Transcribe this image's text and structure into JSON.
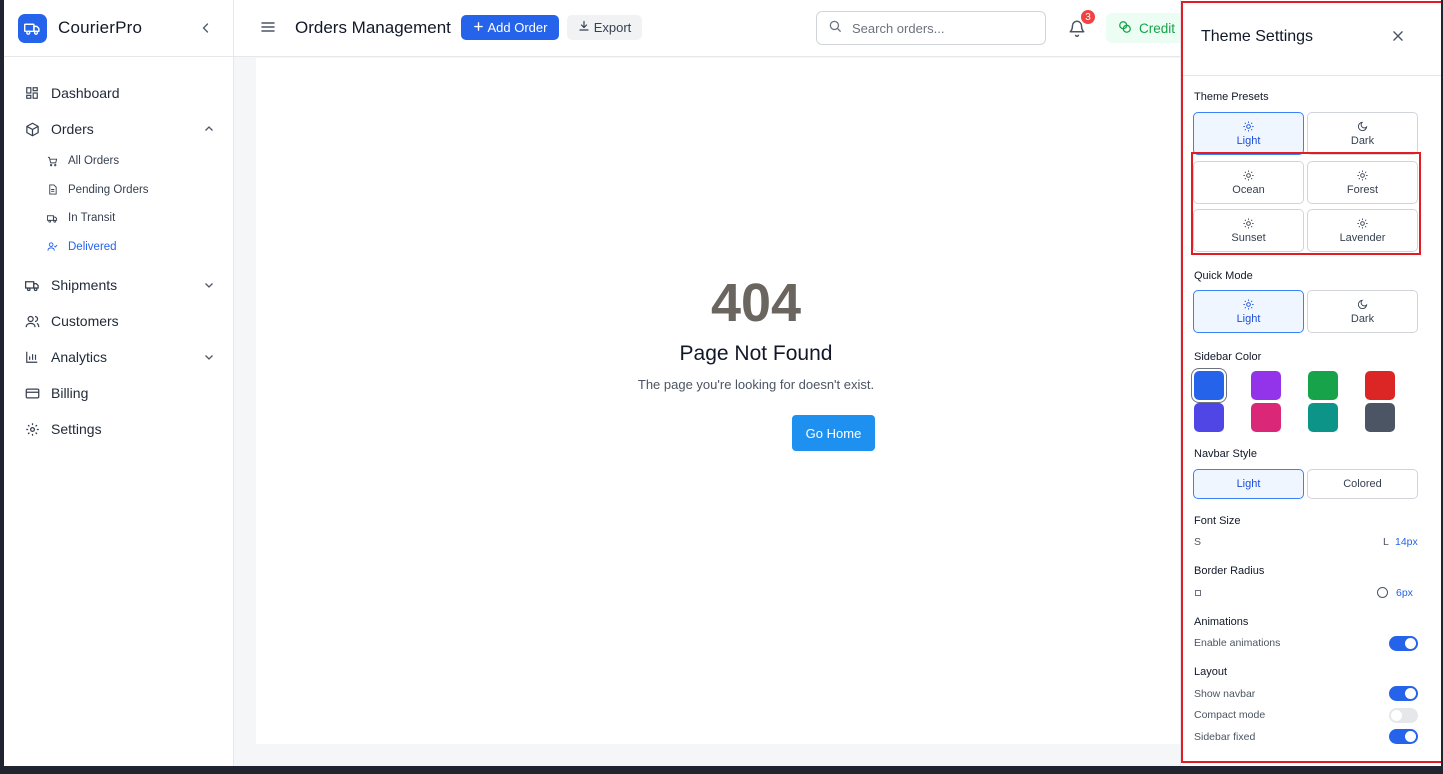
{
  "brand": {
    "name": "CourierPro"
  },
  "sidebar": {
    "items": [
      {
        "label": "Dashboard"
      },
      {
        "label": "Orders"
      },
      {
        "label": "Shipments"
      },
      {
        "label": "Customers"
      },
      {
        "label": "Analytics"
      },
      {
        "label": "Billing"
      },
      {
        "label": "Settings"
      }
    ],
    "orders_sub": [
      {
        "label": "All Orders"
      },
      {
        "label": "Pending Orders"
      },
      {
        "label": "In Transit"
      },
      {
        "label": "Delivered"
      }
    ]
  },
  "topbar": {
    "title": "Orders Management",
    "add_label": "Add Order",
    "export_label": "Export",
    "search_placeholder": "Search orders...",
    "notification_count": "3",
    "credit_label": "Credit"
  },
  "main": {
    "error_code": "404",
    "error_title": "Page Not Found",
    "error_message": "The page you're looking for doesn't exist.",
    "home_button": "Go Home"
  },
  "theme_panel": {
    "title": "Theme Settings",
    "presets_label": "Theme Presets",
    "presets": [
      {
        "label": "Light",
        "icon": "sun-icon",
        "active": true
      },
      {
        "label": "Dark",
        "icon": "moon-icon",
        "active": false
      },
      {
        "label": "Ocean",
        "icon": "sun-icon",
        "active": false
      },
      {
        "label": "Forest",
        "icon": "sun-icon",
        "active": false
      },
      {
        "label": "Sunset",
        "icon": "sun-icon",
        "active": false
      },
      {
        "label": "Lavender",
        "icon": "sun-icon",
        "active": false
      }
    ],
    "quick_mode_label": "Quick Mode",
    "quick_mode": [
      {
        "label": "Light",
        "active": true
      },
      {
        "label": "Dark",
        "active": false
      }
    ],
    "sidebar_color_label": "Sidebar Color",
    "sidebar_colors": [
      "#2563eb",
      "#9333ea",
      "#16a34a",
      "#dc2626",
      "#4f46e5",
      "#db2777",
      "#0d9488",
      "#4b5563"
    ],
    "sidebar_color_selected": "#2563eb",
    "navbar_style_label": "Navbar Style",
    "navbar_styles": [
      {
        "label": "Light",
        "active": true
      },
      {
        "label": "Colored",
        "active": false
      }
    ],
    "font_size_label": "Font Size",
    "font_size_min": "S",
    "font_size_max": "L",
    "font_size_value": "14px",
    "border_radius_label": "Border Radius",
    "border_radius_value": "6px",
    "animations_label": "Animations",
    "enable_animations_label": "Enable animations",
    "enable_animations": true,
    "layout_label": "Layout",
    "layout_options": [
      {
        "label": "Show navbar",
        "on": true
      },
      {
        "label": "Compact mode",
        "on": false
      },
      {
        "label": "Sidebar fixed",
        "on": true
      }
    ]
  },
  "colors": {
    "accent": "#2563eb",
    "home_button": "#1e90f0",
    "badge": "#ef4444",
    "credit_text": "#16a34a",
    "highlight_outline": "#e31b23"
  }
}
